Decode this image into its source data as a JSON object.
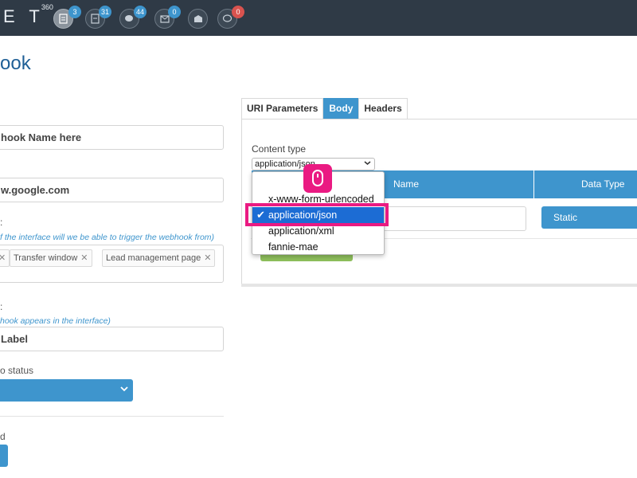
{
  "topbar": {
    "logo_text": "E T",
    "logo_suffix": "360",
    "icons": [
      {
        "name": "documents-icon",
        "badge": "3",
        "badge_color": "#3e95cd"
      },
      {
        "name": "files-icon",
        "badge": "31",
        "badge_color": "#3e95cd"
      },
      {
        "name": "chat-icon",
        "badge": "44",
        "badge_color": "#3e95cd"
      },
      {
        "name": "mail-icon",
        "badge": "0",
        "badge_color": "#3e95cd"
      },
      {
        "name": "inbox-icon",
        "badge": "",
        "badge_color": ""
      },
      {
        "name": "comment-icon",
        "badge": "0",
        "badge_color": "#d9534f"
      }
    ]
  },
  "page": {
    "title": "ook"
  },
  "form": {
    "name_value": "hook Name here",
    "url_value": "w.google.com",
    "interfaces_label_fragment": ":",
    "interfaces_hint": "f the interface will we be able to trigger the webhook from)",
    "tags": [
      "Transfer window",
      "Lead management page"
    ],
    "placement_label_fragment": ":",
    "placement_hint": "hook appears in the interface)",
    "label_value": "Label",
    "status_label": "o status",
    "bottom_label_fragment": "d"
  },
  "panel": {
    "tabs": [
      {
        "label": "URI Parameters",
        "active": false
      },
      {
        "label": "Body",
        "active": true
      },
      {
        "label": "Headers",
        "active": false
      }
    ],
    "content_type_label": "Content type",
    "content_type_value": "application/json",
    "table_headers": {
      "name": "Name",
      "data_type": "Data Type"
    },
    "data_type_value": "Static"
  },
  "dropdown": {
    "options": [
      "x-www-form-urlencoded",
      "application/json",
      "application/xml",
      "fannie-mae"
    ],
    "selected": "application/json",
    "check_glyph": "✔"
  },
  "colors": {
    "accent": "#3e95cd",
    "topbar": "#2f3a46",
    "highlight": "#ea1a82",
    "selected_option": "#1c6cd4",
    "green": "#8ebf5c"
  }
}
